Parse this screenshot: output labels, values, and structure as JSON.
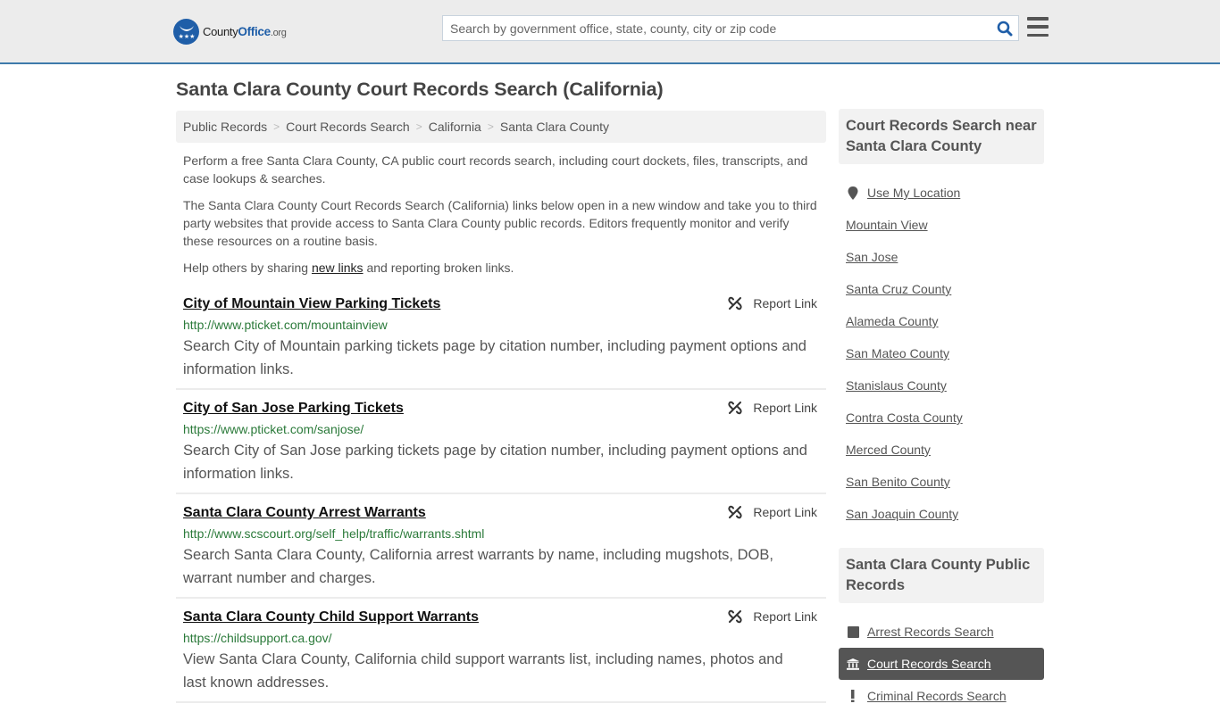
{
  "header": {
    "logo": {
      "name": "County",
      "name_accent": "Office",
      "tld": ".org"
    },
    "search": {
      "placeholder": "Search by government office, state, county, city or zip code",
      "value": ""
    },
    "accent_color": "#3e7aab"
  },
  "page": {
    "title": "Santa Clara County Court Records Search (California)"
  },
  "breadcrumb": [
    {
      "label": "Public Records"
    },
    {
      "label": "Court Records Search"
    },
    {
      "label": "California"
    },
    {
      "label": "Santa Clara County"
    }
  ],
  "intro": {
    "p1": "Perform a free Santa Clara County, CA public court records search, including court dockets, files, transcripts, and case lookups & searches.",
    "p2": "The Santa Clara County Court Records Search (California) links below open in a new window and take you to third party websites that provide access to Santa Clara County public records. Editors frequently monitor and verify these resources on a routine basis.",
    "p3_before": "Help others by sharing ",
    "p3_link": "new links",
    "p3_after": " and reporting broken links."
  },
  "results": [
    {
      "title": "City of Mountain View Parking Tickets",
      "url": "http://www.pticket.com/mountainview",
      "description": "Search City of Mountain parking tickets page by citation number, including payment options and information links.",
      "report_label": "Report Link"
    },
    {
      "title": "City of San Jose Parking Tickets",
      "url": "https://www.pticket.com/sanjose/",
      "description": "Search City of San Jose parking tickets page by citation number, including payment options and information links.",
      "report_label": "Report Link"
    },
    {
      "title": "Santa Clara County Arrest Warrants",
      "url": "http://www.scscourt.org/self_help/traffic/warrants.shtml",
      "description": "Search Santa Clara County, California arrest warrants by name, including mugshots, DOB, warrant number and charges.",
      "report_label": "Report Link"
    },
    {
      "title": "Santa Clara County Child Support Warrants",
      "url": "https://childsupport.ca.gov/",
      "description": "View Santa Clara County, California child support warrants list, including names, photos and last known addresses.",
      "report_label": "Report Link"
    }
  ],
  "sidebar": {
    "nearby": {
      "heading": "Court Records Search near Santa Clara County",
      "use_location": "Use My Location",
      "items": [
        "Mountain View",
        "San Jose",
        "Santa Cruz County",
        "Alameda County",
        "San Mateo County",
        "Stanislaus County",
        "Contra Costa County",
        "Merced County",
        "San Benito County",
        "San Joaquin County"
      ]
    },
    "public_records": {
      "heading": "Santa Clara County Public Records",
      "items": [
        {
          "label": "Arrest Records Search",
          "icon": "square-icon",
          "active": false
        },
        {
          "label": "Court Records Search",
          "icon": "courthouse-icon",
          "active": true
        },
        {
          "label": "Criminal Records Search",
          "icon": "exclamation-icon",
          "active": false
        }
      ]
    }
  }
}
